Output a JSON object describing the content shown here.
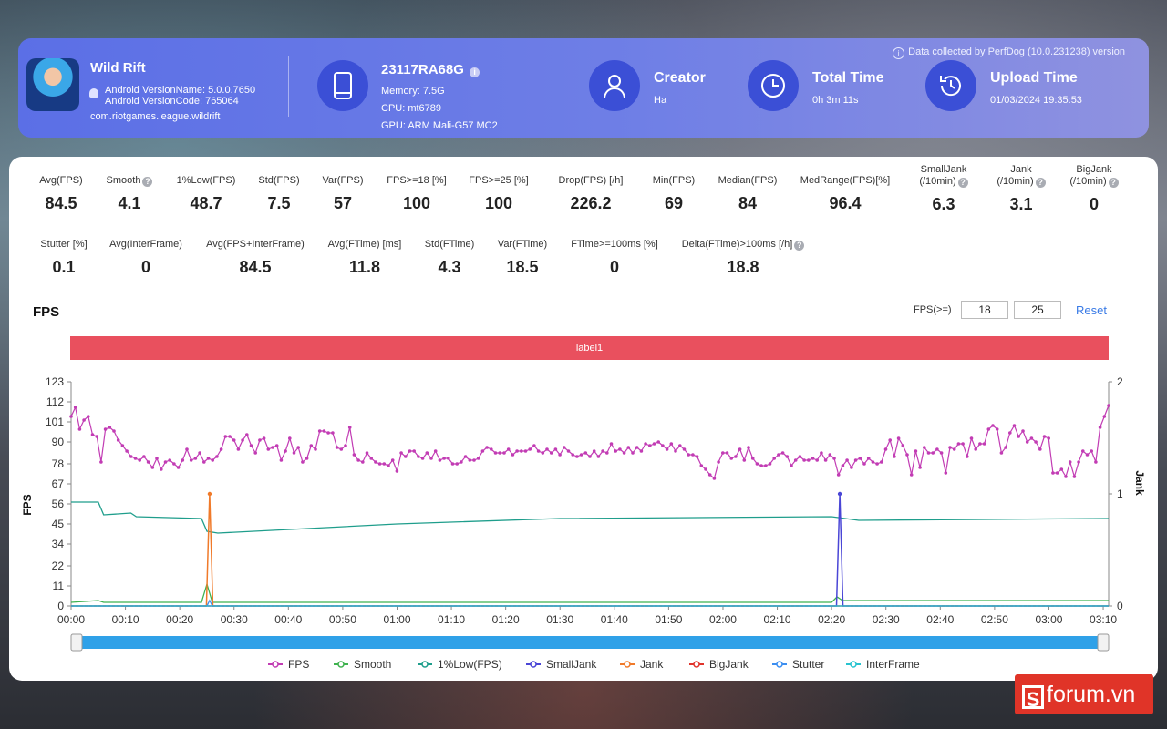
{
  "header": {
    "app": {
      "name": "Wild Rift",
      "version_name": "Android VersionName: 5.0.0.7650",
      "version_code": "Android VersionCode: 765064",
      "package": "com.riotgames.league.wildrift"
    },
    "device": {
      "model": "23117RA68G",
      "memory": "Memory: 7.5G",
      "cpu": "CPU: mt6789",
      "gpu": "GPU: ARM Mali-G57 MC2"
    },
    "creator": {
      "label": "Creator",
      "value": "Ha"
    },
    "total_time": {
      "label": "Total Time",
      "value": "0h 3m 11s"
    },
    "upload_time": {
      "label": "Upload Time",
      "value": "01/03/2024 19:35:53"
    },
    "data_note": "Data collected by PerfDog (10.0.231238) version"
  },
  "stats_row1": [
    {
      "label": "Avg(FPS)",
      "value": "84.5"
    },
    {
      "label": "Smooth",
      "value": "4.1",
      "help": true
    },
    {
      "label": "1%Low(FPS)",
      "value": "48.7"
    },
    {
      "label": "Std(FPS)",
      "value": "7.5"
    },
    {
      "label": "Var(FPS)",
      "value": "57"
    },
    {
      "label": "FPS>=18 [%]",
      "value": "100"
    },
    {
      "label": "FPS>=25 [%]",
      "value": "100"
    },
    {
      "label": "Drop(FPS) [/h]",
      "value": "226.2"
    },
    {
      "label": "Min(FPS)",
      "value": "69"
    },
    {
      "label": "Median(FPS)",
      "value": "84"
    },
    {
      "label": "MedRange(FPS)[%]",
      "value": "96.4"
    },
    {
      "label": "SmallJank",
      "label2": "(/10min)",
      "value": "6.3",
      "help": true
    },
    {
      "label": "Jank",
      "label2": "(/10min)",
      "value": "3.1",
      "help": true
    },
    {
      "label": "BigJank",
      "label2": "(/10min)",
      "value": "0",
      "help": true
    }
  ],
  "stats_row2": [
    {
      "label": "Stutter [%]",
      "value": "0.1"
    },
    {
      "label": "Avg(InterFrame)",
      "value": "0"
    },
    {
      "label": "Avg(FPS+InterFrame)",
      "value": "84.5"
    },
    {
      "label": "Avg(FTime) [ms]",
      "value": "11.8"
    },
    {
      "label": "Std(FTime)",
      "value": "4.3"
    },
    {
      "label": "Var(FTime)",
      "value": "18.5"
    },
    {
      "label": "FTime>=100ms [%]",
      "value": "0"
    },
    {
      "label": "Delta(FTime)>100ms [/h]",
      "value": "18.8",
      "help": true
    }
  ],
  "chart_section": {
    "title": "FPS",
    "threshold_label": "FPS(>=)",
    "threshold1": "18",
    "threshold2": "25",
    "reset_label": "Reset",
    "label_bar": "label1"
  },
  "chart_data": {
    "type": "line",
    "ylabel": "FPS",
    "y2label": "Jank",
    "ylim": [
      0,
      123
    ],
    "y2lim": [
      0,
      2
    ],
    "yticks": [
      "0",
      "11",
      "22",
      "34",
      "45",
      "56",
      "67",
      "78",
      "90",
      "101",
      "112",
      "123"
    ],
    "y2ticks": [
      "0",
      "1",
      "2"
    ],
    "xticks": [
      "00:00",
      "00:10",
      "00:20",
      "00:30",
      "00:40",
      "00:50",
      "01:00",
      "01:10",
      "01:20",
      "01:30",
      "01:40",
      "01:50",
      "02:00",
      "02:10",
      "02:20",
      "02:30",
      "02:40",
      "02:50",
      "03:00",
      "03:10"
    ],
    "x_range_seconds": [
      0,
      191
    ],
    "legend": [
      {
        "name": "FPS",
        "color": "#c23cb4"
      },
      {
        "name": "Smooth",
        "color": "#3fb24f"
      },
      {
        "name": "1%Low(FPS)",
        "color": "#1f9e8c"
      },
      {
        "name": "SmallJank",
        "color": "#4a46d6"
      },
      {
        "name": "Jank",
        "color": "#f07a2a"
      },
      {
        "name": "BigJank",
        "color": "#e0342c"
      },
      {
        "name": "Stutter",
        "color": "#3b8ef0"
      },
      {
        "name": "InterFrame",
        "color": "#28c3cf"
      }
    ],
    "series": [
      {
        "name": "FPS",
        "x_step_seconds": 1,
        "values": [
          104,
          109,
          97,
          102,
          104,
          94,
          93,
          79,
          97,
          98,
          96,
          91,
          88,
          85,
          82,
          81,
          80,
          82,
          79,
          76,
          81,
          75,
          79,
          80,
          78,
          76,
          80,
          86,
          80,
          81,
          84,
          79,
          81,
          80,
          82,
          86,
          93,
          93,
          91,
          86,
          91,
          94,
          88,
          84,
          91,
          92,
          86,
          87,
          88,
          80,
          85,
          92,
          84,
          87,
          79,
          81,
          88,
          86,
          96,
          96,
          95,
          95,
          87,
          86,
          88,
          98,
          83,
          80,
          79,
          84,
          81,
          79,
          78,
          78,
          77,
          80,
          74,
          84,
          82,
          85,
          85,
          82,
          81,
          84,
          81,
          85,
          80,
          81,
          81,
          78,
          78,
          79,
          82,
          80,
          80,
          81,
          85,
          87,
          86,
          84,
          84,
          84,
          86,
          83,
          85,
          85,
          85,
          86,
          88,
          85,
          84,
          86,
          84,
          86,
          83,
          87,
          85,
          83,
          82,
          83,
          84,
          82,
          85,
          82,
          85,
          84,
          89,
          85,
          86,
          84,
          87,
          84,
          87,
          85,
          89,
          88,
          89,
          90,
          88,
          86,
          89,
          85,
          88,
          86,
          83,
          83,
          82,
          77,
          75,
          72,
          70,
          79,
          84,
          84,
          81,
          82,
          86,
          80,
          87,
          81,
          78,
          77,
          77,
          78,
          81,
          83,
          84,
          82,
          77,
          80,
          82,
          80,
          80,
          81,
          80,
          84,
          80,
          83,
          81,
          72,
          77,
          80,
          76,
          80,
          81,
          78,
          81,
          79,
          78,
          79,
          86,
          91,
          82,
          92,
          88,
          83,
          72,
          85,
          76,
          87,
          84,
          84,
          86,
          84,
          73,
          87,
          86,
          89,
          89,
          82,
          92,
          86,
          89,
          89,
          97,
          99,
          97,
          84,
          87,
          95,
          99,
          93,
          96,
          90,
          92,
          90,
          86,
          93,
          92,
          73,
          73,
          75,
          71,
          79,
          71,
          79,
          85,
          83,
          85,
          79,
          98,
          104,
          110
        ]
      },
      {
        "name": "1%Low(FPS)",
        "points": [
          [
            0,
            57
          ],
          [
            5,
            57
          ],
          [
            6,
            50
          ],
          [
            11,
            51
          ],
          [
            12,
            49
          ],
          [
            24,
            48
          ],
          [
            25,
            41
          ],
          [
            27,
            40
          ],
          [
            60,
            45
          ],
          [
            90,
            48
          ],
          [
            140,
            49
          ],
          [
            145,
            47
          ],
          [
            191,
            48
          ]
        ]
      },
      {
        "name": "Smooth",
        "points": [
          [
            0,
            2
          ],
          [
            5,
            3
          ],
          [
            6,
            2
          ],
          [
            24,
            2
          ],
          [
            25,
            12
          ],
          [
            26,
            2
          ],
          [
            140,
            2
          ],
          [
            141,
            5
          ],
          [
            142,
            3
          ],
          [
            191,
            3
          ]
        ]
      },
      {
        "name": "Jank",
        "points": [
          [
            0,
            0
          ],
          [
            24.9,
            0
          ],
          [
            25.5,
            1
          ],
          [
            26.1,
            0
          ],
          [
            191,
            0
          ]
        ]
      },
      {
        "name": "SmallJank",
        "points": [
          [
            0,
            0
          ],
          [
            140.9,
            0
          ],
          [
            141.5,
            1
          ],
          [
            142.1,
            0
          ],
          [
            191,
            0
          ]
        ]
      },
      {
        "name": "BigJank",
        "points": [
          [
            0,
            0
          ],
          [
            191,
            0
          ]
        ]
      },
      {
        "name": "Stutter",
        "points": [
          [
            0,
            0
          ],
          [
            25,
            0
          ],
          [
            25.5,
            0.05
          ],
          [
            26,
            0
          ],
          [
            191,
            0
          ]
        ]
      },
      {
        "name": "InterFrame",
        "points": [
          [
            0,
            0
          ],
          [
            191,
            0
          ]
        ]
      }
    ]
  },
  "watermark": {
    "text": "forum.vn",
    "mark": "S"
  }
}
